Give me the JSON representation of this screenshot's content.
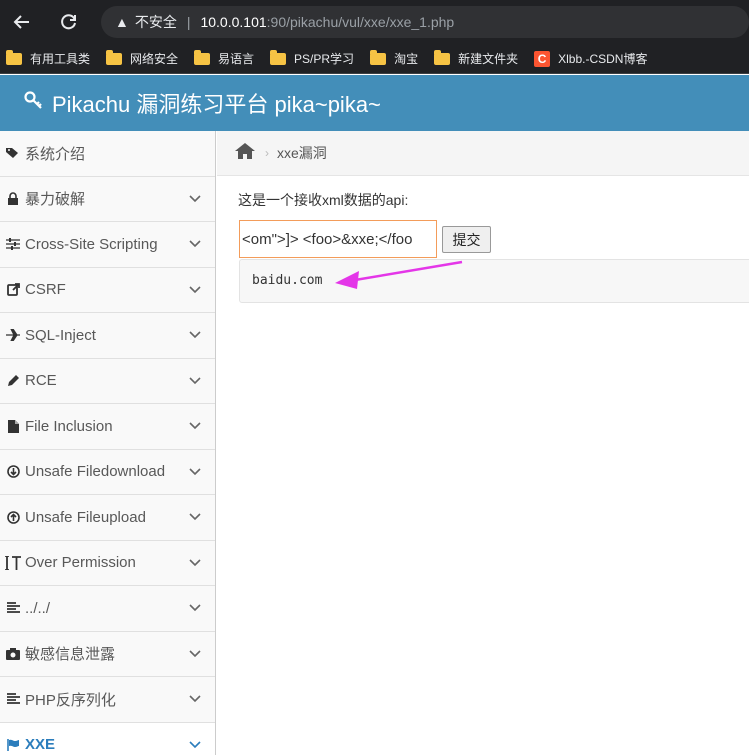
{
  "browser": {
    "insecure_label": "不安全",
    "url_host": "10.0.0.101",
    "url_rest": ":90/pikachu/vul/xxe/xxe_1.php"
  },
  "bookmarks": [
    {
      "label": "有用工具类",
      "icon": "folder-icon"
    },
    {
      "label": "网络安全",
      "icon": "folder-icon"
    },
    {
      "label": "易语言",
      "icon": "folder-icon"
    },
    {
      "label": "PS/PR学习",
      "icon": "folder-icon"
    },
    {
      "label": "淘宝",
      "icon": "folder-icon"
    },
    {
      "label": "新建文件夹",
      "icon": "folder-icon"
    },
    {
      "label": "Xlbb.-CSDN博客",
      "icon": "csdn-icon",
      "icon_letter": "C"
    }
  ],
  "app": {
    "title": "Pikachu 漏洞练习平台 pika~pika~"
  },
  "sidebar": {
    "items": [
      {
        "label": "系统介绍",
        "icon": "tags-icon"
      },
      {
        "label": "暴力破解",
        "icon": "lock-icon"
      },
      {
        "label": "Cross-Site Scripting",
        "icon": "sliders-icon"
      },
      {
        "label": "CSRF",
        "icon": "share-icon"
      },
      {
        "label": "SQL-Inject",
        "icon": "plane-icon"
      },
      {
        "label": "RCE",
        "icon": "pencil-icon"
      },
      {
        "label": "File Inclusion",
        "icon": "file-icon"
      },
      {
        "label": "Unsafe Filedownload",
        "icon": "download-icon"
      },
      {
        "label": "Unsafe Fileupload",
        "icon": "upload-icon"
      },
      {
        "label": "Over Permission",
        "icon": "text-height-icon"
      },
      {
        "label": "../../",
        "icon": "align-left-icon"
      },
      {
        "label": "敏感信息泄露",
        "icon": "camera-icon"
      },
      {
        "label": "PHP反序列化",
        "icon": "align-left-icon"
      },
      {
        "label": "XXE",
        "icon": "flag-icon"
      }
    ]
  },
  "breadcrumb": {
    "current": "xxe漏洞"
  },
  "main": {
    "api_description": "这是一个接收xml数据的api:",
    "xml_input_value": "om\">]> <foo>&xxe;</foo>",
    "submit_label": "提交",
    "result_text": "baidu.com"
  },
  "colors": {
    "header_bg": "#438eb9",
    "active_item": "#2b7dbc",
    "arrow": "#e436e8",
    "input_border": "#f39c5a"
  }
}
